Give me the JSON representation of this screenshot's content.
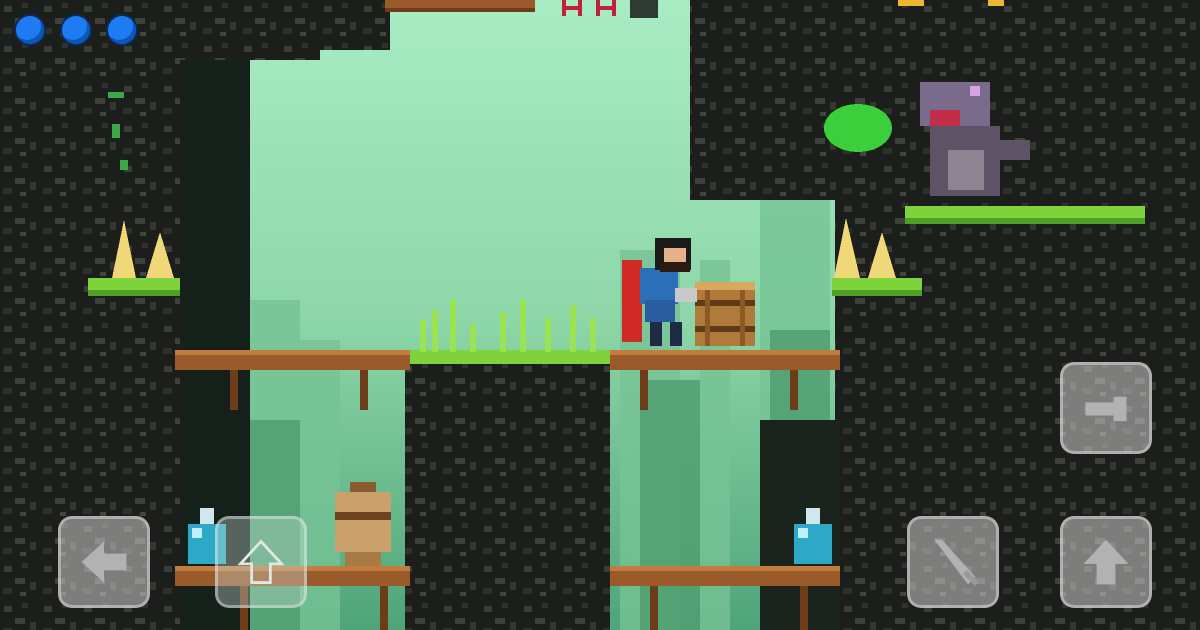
{
  "game": {
    "screen": "level",
    "title": ""
  },
  "hud": {
    "mana_orbs": {
      "current": 3,
      "max": 3,
      "color": "#1e7bf2"
    },
    "lives_markers": {
      "shown": 2,
      "empty": 1,
      "color": "#c0203a"
    }
  },
  "controls": {
    "left": {
      "icon": "arrow-left-icon"
    },
    "jump": {
      "icon": "arrow-up-icon"
    },
    "attack": {
      "icon": "sword-icon"
    },
    "magic": {
      "icon": "fireball-icon"
    },
    "down": {
      "icon": "arrow-up-outline-icon"
    }
  },
  "entities": {
    "player": "knight-with-red-cape",
    "enemy": "purple-dinosaur-spitting-green-acid",
    "items": [
      "wooden-barrel",
      "clay-vase",
      "blue-potion",
      "blue-potion"
    ],
    "hazards": [
      "spikes-left",
      "spikes-right"
    ]
  },
  "palette": {
    "sky": "#9fe2b8",
    "forest_far": "#67b98a",
    "rock_dark": "#1a1d19",
    "rock_mid": "#3a3d36",
    "moss": "#7ed23a",
    "wood": "#9a5a2a",
    "acid": "#3ccf3c"
  }
}
